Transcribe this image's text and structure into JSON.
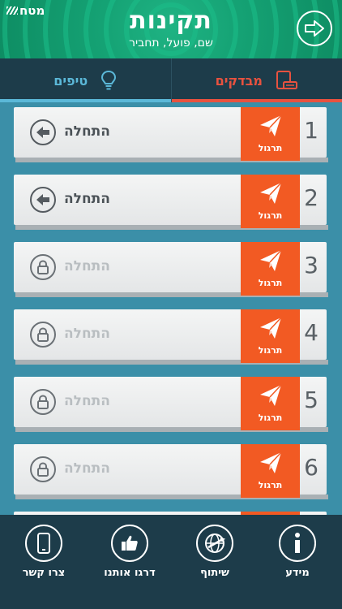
{
  "header": {
    "brand": "מטח",
    "title": "תקינות",
    "subtitle": "שם, פועל, תחביר"
  },
  "tabs": [
    {
      "label": "טיפים",
      "active": false,
      "color": "#5bb8d8"
    },
    {
      "label": "מבדקים",
      "active": true,
      "color": "#e8523f"
    }
  ],
  "tests": [
    {
      "number": "1",
      "practice_label": "תרגול",
      "start_label": "התחלה",
      "locked": false
    },
    {
      "number": "2",
      "practice_label": "תרגול",
      "start_label": "התחלה",
      "locked": false
    },
    {
      "number": "3",
      "practice_label": "תרגול",
      "start_label": "התחלה",
      "locked": true
    },
    {
      "number": "4",
      "practice_label": "תרגול",
      "start_label": "התחלה",
      "locked": true
    },
    {
      "number": "5",
      "practice_label": "תרגול",
      "start_label": "התחלה",
      "locked": true
    },
    {
      "number": "6",
      "practice_label": "תרגול",
      "start_label": "התחלה",
      "locked": true
    }
  ],
  "footer": {
    "contact": "צרו קשר",
    "rate": "דרגו אותנו",
    "share": "שיתוף",
    "info": "מידע"
  },
  "colors": {
    "practice": "#f25a23",
    "header": "#15a274",
    "background": "#3b8fa8",
    "bar": "#1d3c4a"
  },
  "icons": {
    "header_button": "next-arrow-icon",
    "tips_tab": "lightbulb-icon",
    "tests_tab": "tablet-icon",
    "practice": "paper-plane-icon",
    "start": "arrow-left-icon",
    "locked": "lock-icon"
  }
}
